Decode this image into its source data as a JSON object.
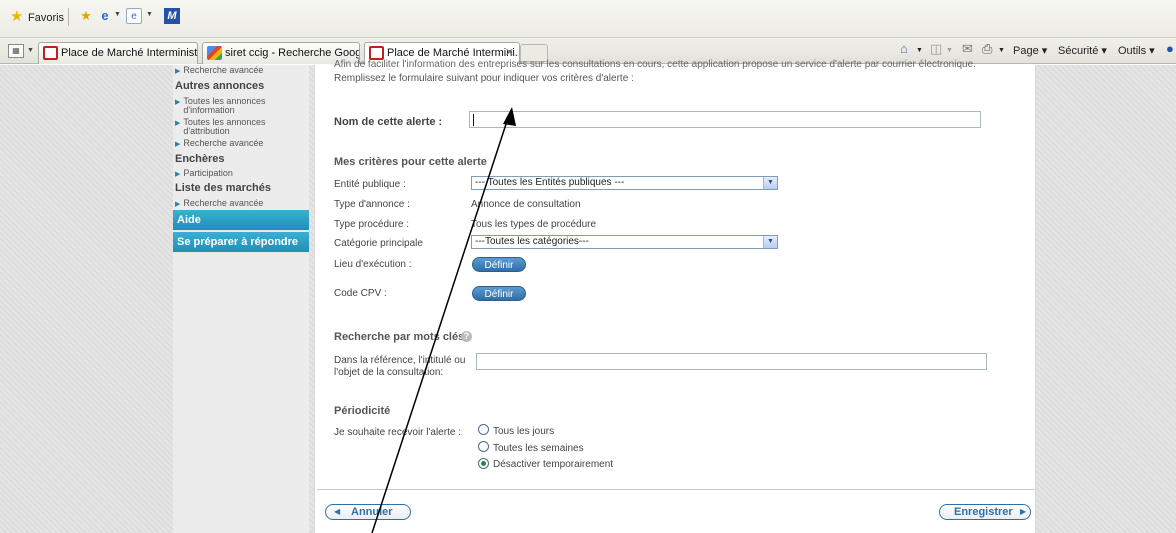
{
  "browser": {
    "favorites_label": "Favoris",
    "tabs": [
      {
        "label": "Place de Marché Interministé..."
      },
      {
        "label": "siret ccig - Recherche Google"
      },
      {
        "label": "Place de Marché Intermini..."
      }
    ],
    "commands": {
      "page": "Page",
      "security": "Sécurité",
      "tools": "Outils"
    }
  },
  "sidebar": {
    "top_item": "Recherche avancée",
    "sections": [
      {
        "heading": "Autres annonces",
        "items": [
          "Toutes les annonces d'information",
          "Toutes les annonces d'attribution",
          "Recherche avancée"
        ]
      },
      {
        "heading": "Enchères",
        "items": [
          "Participation"
        ]
      },
      {
        "heading": "Liste des marchés",
        "items": [
          "Recherche avancée"
        ]
      }
    ],
    "blue_items": [
      "Aide",
      "Se préparer à répondre"
    ]
  },
  "form": {
    "intro_line1": "Afin de faciliter l'information des entreprises sur les consultations en cours, cette application propose un service d'alerte par courrier électronique.",
    "intro_line2": "Remplissez le formulaire suivant pour indiquer vos critères d'alerte :",
    "alert_name_label": "Nom de cette alerte :",
    "alert_name_value": "",
    "criteria_title": "Mes critères pour cette alerte",
    "entity_label": "Entité publique :",
    "entity_value": "--- Toutes les Entités publiques ---",
    "notice_type_label": "Type d'annonce :",
    "notice_type_value": "Annonce de consultation",
    "procedure_type_label": "Type procédure :",
    "procedure_type_value": "Tous les types de procédure",
    "category_label": "Catégorie principale",
    "category_value": "---Toutes les catégories---",
    "place_label": "Lieu d'exécution :",
    "define_label": "Définir",
    "cpv_label": "Code CPV :",
    "keywords_title": "Recherche par mots clés",
    "keywords_label_line1": "Dans la référence, l'intitulé ou",
    "keywords_label_line2": "l'objet de la consultation:",
    "keywords_value": "",
    "periodicity_title": "Périodicité",
    "periodicity_label": "Je souhaite recevoir l'alerte :",
    "periodicity_options": [
      "Tous les jours",
      "Toutes les semaines",
      "Désactiver temporairement"
    ],
    "periodicity_selected": 2,
    "cancel_label": "Annuler",
    "save_label": "Enregistrer"
  }
}
